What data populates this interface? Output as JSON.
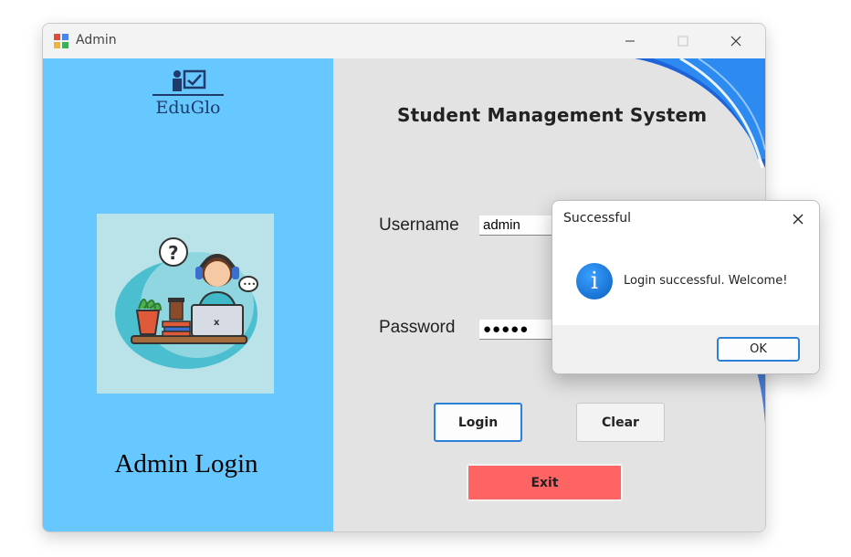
{
  "window": {
    "title": "Admin",
    "icon": "app-window-icon",
    "controls": {
      "minimize": "minimize-icon",
      "maximize": "maximize-icon",
      "close": "close-icon"
    }
  },
  "left_panel": {
    "logo_text": "EduGlo",
    "logo_icon": "teacher-board-icon",
    "illustration": "student-headset-laptop-illustration",
    "heading": "Admin Login",
    "bg_color": "#66c8ff"
  },
  "right_panel": {
    "title": "Student Management System",
    "username_label": "Username",
    "username_value": "admin",
    "password_label": "Password",
    "password_value": "●●●●●",
    "login_label": "Login",
    "clear_label": "Clear",
    "exit_label": "Exit",
    "exit_color": "#ff6464",
    "accent_color": "#2d7fd8"
  },
  "dialog": {
    "title": "Successful",
    "message": "Login successful. Welcome!",
    "icon": "info-icon",
    "ok_label": "OK"
  }
}
